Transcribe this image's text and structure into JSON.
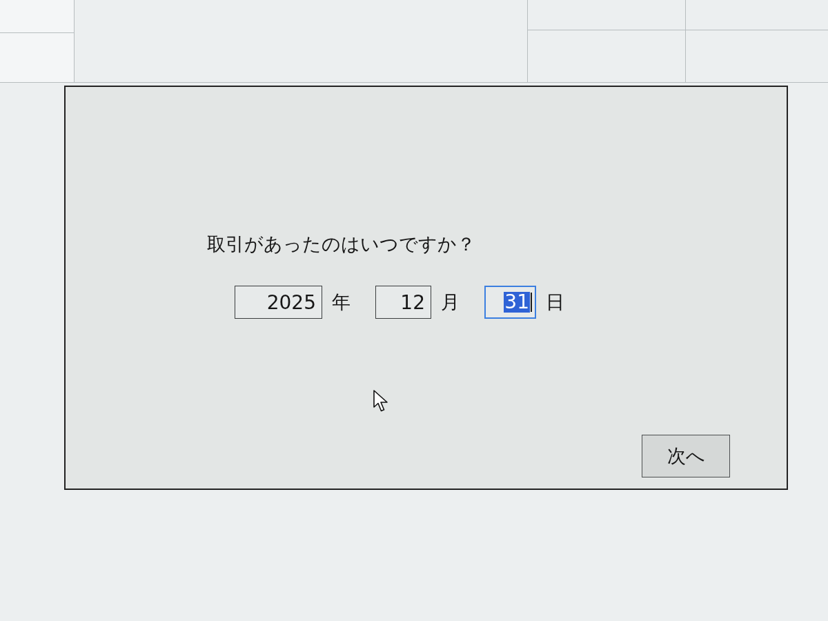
{
  "dialog": {
    "question": "取引があったのはいつですか？",
    "date_fields": [
      {
        "value": "2025",
        "unit": "年",
        "focused": false
      },
      {
        "value": "12",
        "unit": "月",
        "focused": false
      },
      {
        "value": "31",
        "unit": "日",
        "focused": true
      }
    ],
    "buttons": [
      {
        "label": "次へ"
      }
    ]
  }
}
